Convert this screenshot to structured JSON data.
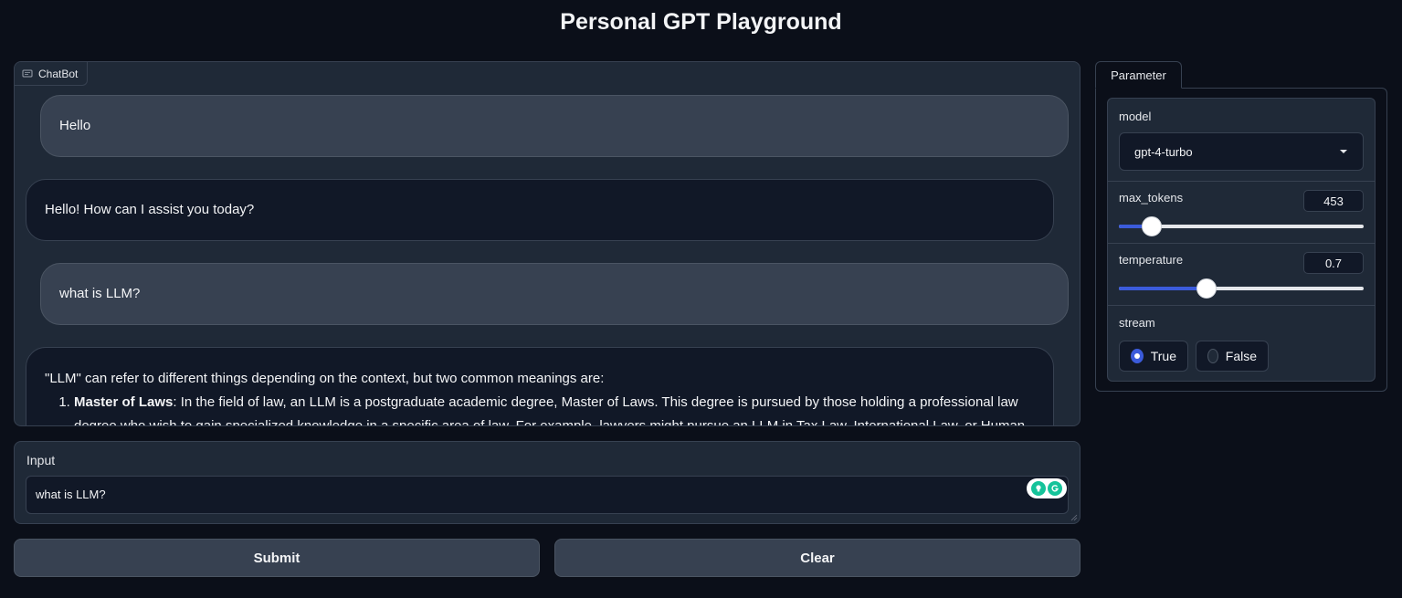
{
  "app": {
    "title": "Personal GPT Playground"
  },
  "chatbot": {
    "label": "ChatBot",
    "messages": [
      {
        "role": "user",
        "text": "Hello"
      },
      {
        "role": "bot",
        "text": "Hello! How can I assist you today?"
      },
      {
        "role": "user",
        "text": "what is LLM?"
      },
      {
        "role": "bot",
        "intro": "\"LLM\" can refer to different things depending on the context, but two common meanings are:",
        "list": [
          {
            "bold": "Master of Laws",
            "text": ": In the field of law, an LLM is a postgraduate academic degree, Master of Laws. This degree is pursued by those holding a professional law degree who wish to gain specialized knowledge in a specific area of law. For example, lawyers might pursue an LLM in Tax Law, International Law, or Human"
          }
        ]
      }
    ]
  },
  "input": {
    "label": "Input",
    "value": "what is LLM?"
  },
  "buttons": {
    "submit": "Submit",
    "clear": "Clear"
  },
  "parameter": {
    "tab": "Parameter",
    "model": {
      "label": "model",
      "value": "gpt-4-turbo"
    },
    "max_tokens": {
      "label": "max_tokens",
      "value": "453",
      "fraction": 0.135
    },
    "temperature": {
      "label": "temperature",
      "value": "0.7",
      "fraction": 0.36
    },
    "stream": {
      "label": "stream",
      "options": [
        "True",
        "False"
      ],
      "selected": "True"
    }
  },
  "colors": {
    "accent": "#3b5bdb",
    "background": "#0b0f19",
    "panel": "#1f2937"
  }
}
